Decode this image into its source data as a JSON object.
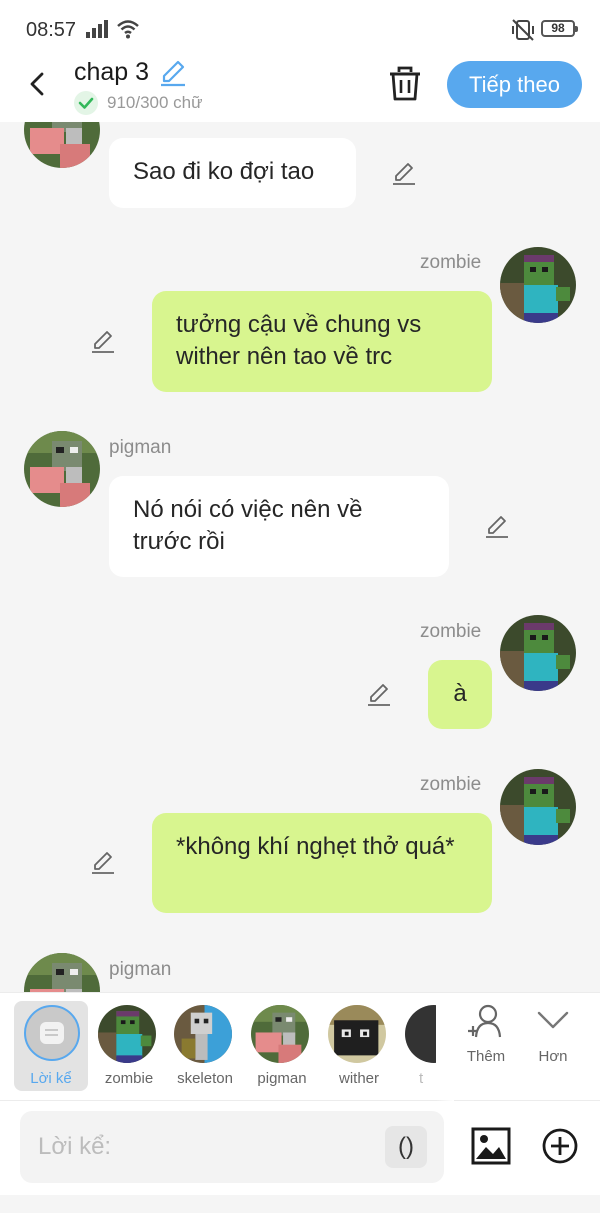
{
  "status_bar": {
    "time": "08:57",
    "battery": "98"
  },
  "header": {
    "title": "chap 3",
    "word_count": "910/300 chữ",
    "next_label": "Tiếp theo"
  },
  "messages": [
    {
      "side": "left",
      "speaker": "",
      "text": "Sao đi ko đợi tao"
    },
    {
      "side": "right",
      "speaker": "zombie",
      "text": "tưởng cậu về chung vs wither nên tao về trc"
    },
    {
      "side": "left",
      "speaker": "pigman",
      "text": "Nó nói có việc nên về trước rồi"
    },
    {
      "side": "right",
      "speaker": "zombie",
      "text": "à"
    },
    {
      "side": "right",
      "speaker": "zombie",
      "text": "*không khí nghẹt thở quá*"
    },
    {
      "side": "left",
      "speaker": "pigman",
      "text": ""
    }
  ],
  "character_bar": {
    "narrator_label": "Lời kể",
    "characters": [
      "zombie",
      "skeleton",
      "pigman",
      "wither",
      "t"
    ],
    "add_label": "Thêm",
    "more_label": "Hơn"
  },
  "input": {
    "placeholder": "Lời kể:",
    "paren_label": "()"
  },
  "colors": {
    "accent": "#58a8ee",
    "right_bubble": "#d8f58f",
    "left_bubble": "#ffffff",
    "background": "#f5f5f5"
  },
  "icons": [
    "back-arrow-icon",
    "pencil-icon",
    "check-icon",
    "trash-icon",
    "add-person-icon",
    "chevron-down-icon",
    "image-icon",
    "plus-circle-icon",
    "signal-icon",
    "wifi-icon",
    "mute-icon",
    "battery-icon"
  ]
}
